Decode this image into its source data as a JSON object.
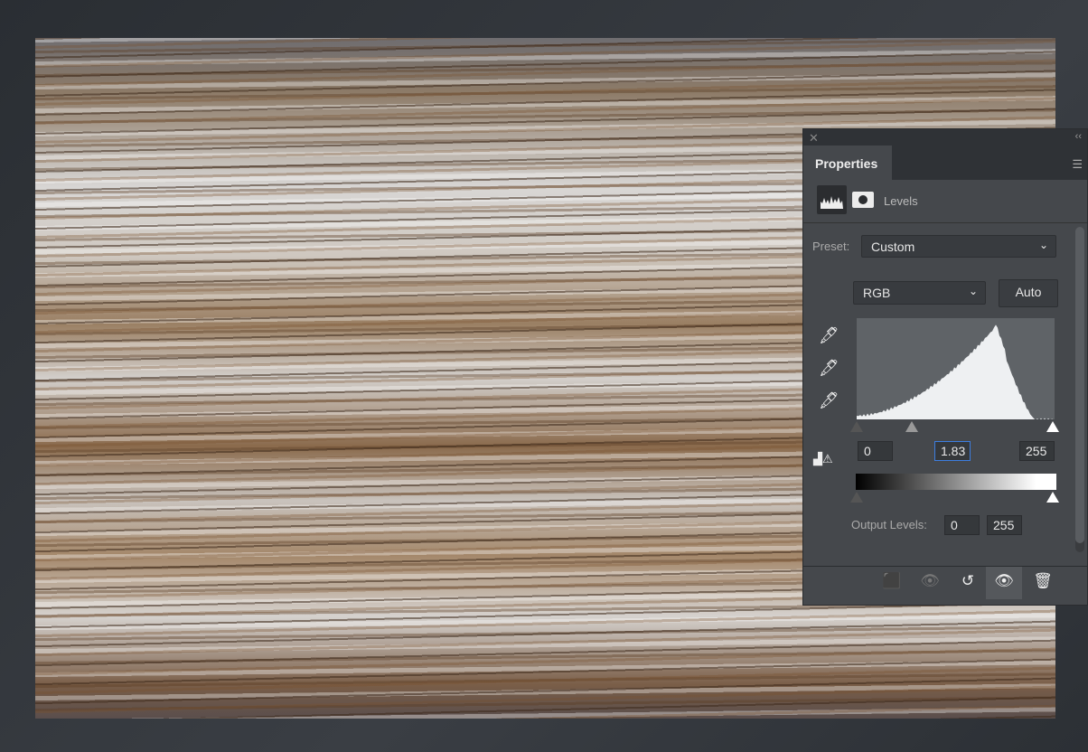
{
  "panel": {
    "title": "Properties",
    "adjustment": "Levels",
    "preset_label": "Preset:",
    "preset_value": "Custom",
    "channel": "RGB",
    "auto_label": "Auto",
    "input_black": "0",
    "input_gamma": "1.83",
    "input_white": "255",
    "output_label": "Output Levels:",
    "output_black": "0",
    "output_white": "255"
  },
  "icons": [
    "close-icon",
    "collapse-icon",
    "panel-menu-icon",
    "levels-icon",
    "mask-icon",
    "black-eyedropper-icon",
    "gray-eyedropper-icon",
    "white-eyedropper-icon",
    "clipping-warning-icon",
    "clip-to-layer-icon",
    "view-previous-icon",
    "reset-icon",
    "visibility-icon",
    "trash-icon"
  ]
}
